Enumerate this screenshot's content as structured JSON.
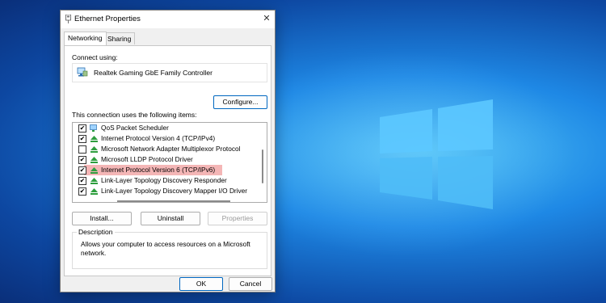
{
  "window": {
    "title": "Ethernet Properties",
    "close_glyph": "✕"
  },
  "tabs": [
    {
      "label": "Networking",
      "active": true
    },
    {
      "label": "Sharing",
      "active": false
    }
  ],
  "connect_using": {
    "label": "Connect using:",
    "adapter": "Realtek Gaming GbE Family Controller",
    "adapter_icon": "network-adapter-icon"
  },
  "buttons": {
    "configure": "Configure...",
    "install": "Install...",
    "uninstall": "Uninstall",
    "properties": "Properties",
    "ok": "OK",
    "cancel": "Cancel"
  },
  "items_label": "This connection uses the following items:",
  "items": [
    {
      "label": "QoS Packet Scheduler",
      "checked": true,
      "icon": "scheduler-icon"
    },
    {
      "label": "Internet Protocol Version 4 (TCP/IPv4)",
      "checked": true,
      "icon": "protocol-icon"
    },
    {
      "label": "Microsoft Network Adapter Multiplexor Protocol",
      "checked": false,
      "icon": "protocol-icon"
    },
    {
      "label": "Microsoft LLDP Protocol Driver",
      "checked": true,
      "icon": "protocol-icon"
    },
    {
      "label": "Internet Protocol Version 6 (TCP/IPv6)",
      "checked": true,
      "icon": "protocol-icon",
      "highlighted": true
    },
    {
      "label": "Link-Layer Topology Discovery Responder",
      "checked": true,
      "icon": "protocol-icon"
    },
    {
      "label": "Link-Layer Topology Discovery Mapper I/O Driver",
      "checked": true,
      "icon": "protocol-icon"
    }
  ],
  "description": {
    "legend": "Description",
    "text": "Allows your computer to access resources on a Microsoft network."
  },
  "colors": {
    "highlight": "#f4b6b6",
    "accent": "#0067c0",
    "protocol_icon": "#2e9e3e"
  }
}
